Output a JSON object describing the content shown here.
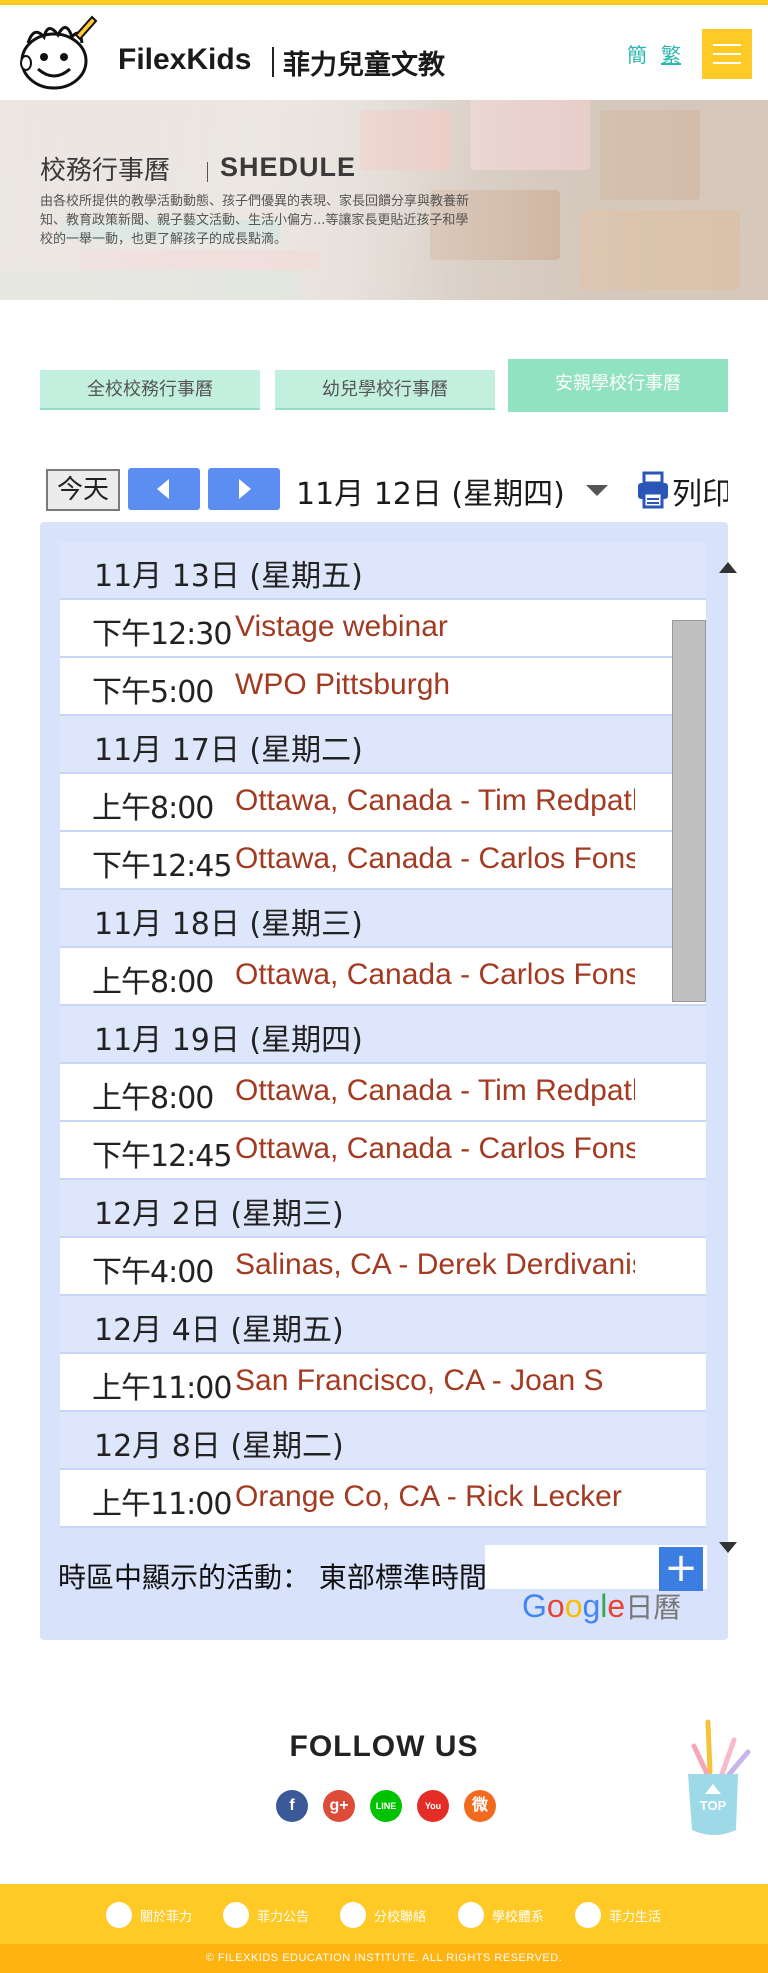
{
  "header": {
    "brand_en": "FilexKids",
    "brand_zh": "菲力兒童文教",
    "lang_simplified": "簡",
    "lang_traditional": "繁",
    "accent_color": "#ffc926"
  },
  "banner": {
    "title_zh": "校務行事曆",
    "title_en": "SHEDULE",
    "description": "由各校所提供的教學活動動態、孩子們優異的表現、家長回饋分享與教養新知、教育政策新聞、親子藝文活動、生活小偏方...等讓家長更貼近孩子和學校的一舉一動，也更了解孩子的成長點滴。"
  },
  "tabs": [
    {
      "label": "全校校務行事曆",
      "active": false
    },
    {
      "label": "幼兒學校行事曆",
      "active": false
    },
    {
      "label": "安親學校行事曆",
      "active": true
    }
  ],
  "calendar": {
    "today_label": "今天",
    "current_date": "11月 12日 (星期四)",
    "print_label": "列印",
    "rows": [
      {
        "kind": "date",
        "text": "11月 13日 (星期五)"
      },
      {
        "kind": "event",
        "time": "下午12:30",
        "title": "Vistage webinar"
      },
      {
        "kind": "event",
        "time": "下午5:00",
        "title": "WPO Pittsburgh"
      },
      {
        "kind": "date",
        "text": "11月 17日 (星期二)"
      },
      {
        "kind": "event",
        "time": "上午8:00",
        "title": "Ottawa, Canada - Tim Redpath"
      },
      {
        "kind": "event",
        "time": "下午12:45",
        "title": "Ottawa, Canada - Carlos Fonseca"
      },
      {
        "kind": "date",
        "text": "11月 18日 (星期三)"
      },
      {
        "kind": "event",
        "time": "上午8:00",
        "title": "Ottawa, Canada - Carlos Fonseca"
      },
      {
        "kind": "date",
        "text": "11月 19日 (星期四)"
      },
      {
        "kind": "event",
        "time": "上午8:00",
        "title": "Ottawa, Canada - Tim Redpath"
      },
      {
        "kind": "event",
        "time": "下午12:45",
        "title": "Ottawa, Canada - Carlos Fonseca"
      },
      {
        "kind": "date",
        "text": "12月 2日 (星期三)"
      },
      {
        "kind": "event",
        "time": "下午4:00",
        "title": "Salinas, CA - Derek Derdivanis"
      },
      {
        "kind": "date",
        "text": "12月 4日 (星期五)"
      },
      {
        "kind": "event",
        "time": "上午11:00",
        "title": "San Francisco, CA - Joan S"
      },
      {
        "kind": "date",
        "text": "12月 8日 (星期二)"
      },
      {
        "kind": "event",
        "time": "上午11:00",
        "title": "Orange Co, CA - Rick Lecker"
      }
    ],
    "timezone_text": "時區中顯示的活動： 東部標準時間",
    "gcal_logo_text": "Google",
    "gcal_word": "日曆",
    "event_title_color": "#a33a22"
  },
  "follow": {
    "title": "FOLLOW US",
    "social": [
      {
        "icon": "facebook-icon",
        "glyph": "f",
        "color": "#3b5998"
      },
      {
        "icon": "google-plus-icon",
        "glyph": "g+",
        "color": "#dd4b39"
      },
      {
        "icon": "line-icon",
        "glyph": "LINE",
        "color": "#00c300"
      },
      {
        "icon": "youtube-icon",
        "glyph": "You",
        "color": "#e52d27"
      },
      {
        "icon": "weibo-icon",
        "glyph": "微",
        "color": "#f26a20"
      }
    ],
    "top_label": "TOP"
  },
  "footer": {
    "items": [
      {
        "label": "關於菲力",
        "icon": "flag-icon"
      },
      {
        "label": "菲力公告",
        "icon": "megaphone-icon"
      },
      {
        "label": "分校聯絡",
        "icon": "mail-icon"
      },
      {
        "label": "學校體系",
        "icon": "layers-icon"
      },
      {
        "label": "菲力生活",
        "icon": "heart-icon"
      }
    ],
    "copyright": "© FILEXKIDS EDUCATION INSTITUTE. ALL RIGHTS RESERVED."
  }
}
